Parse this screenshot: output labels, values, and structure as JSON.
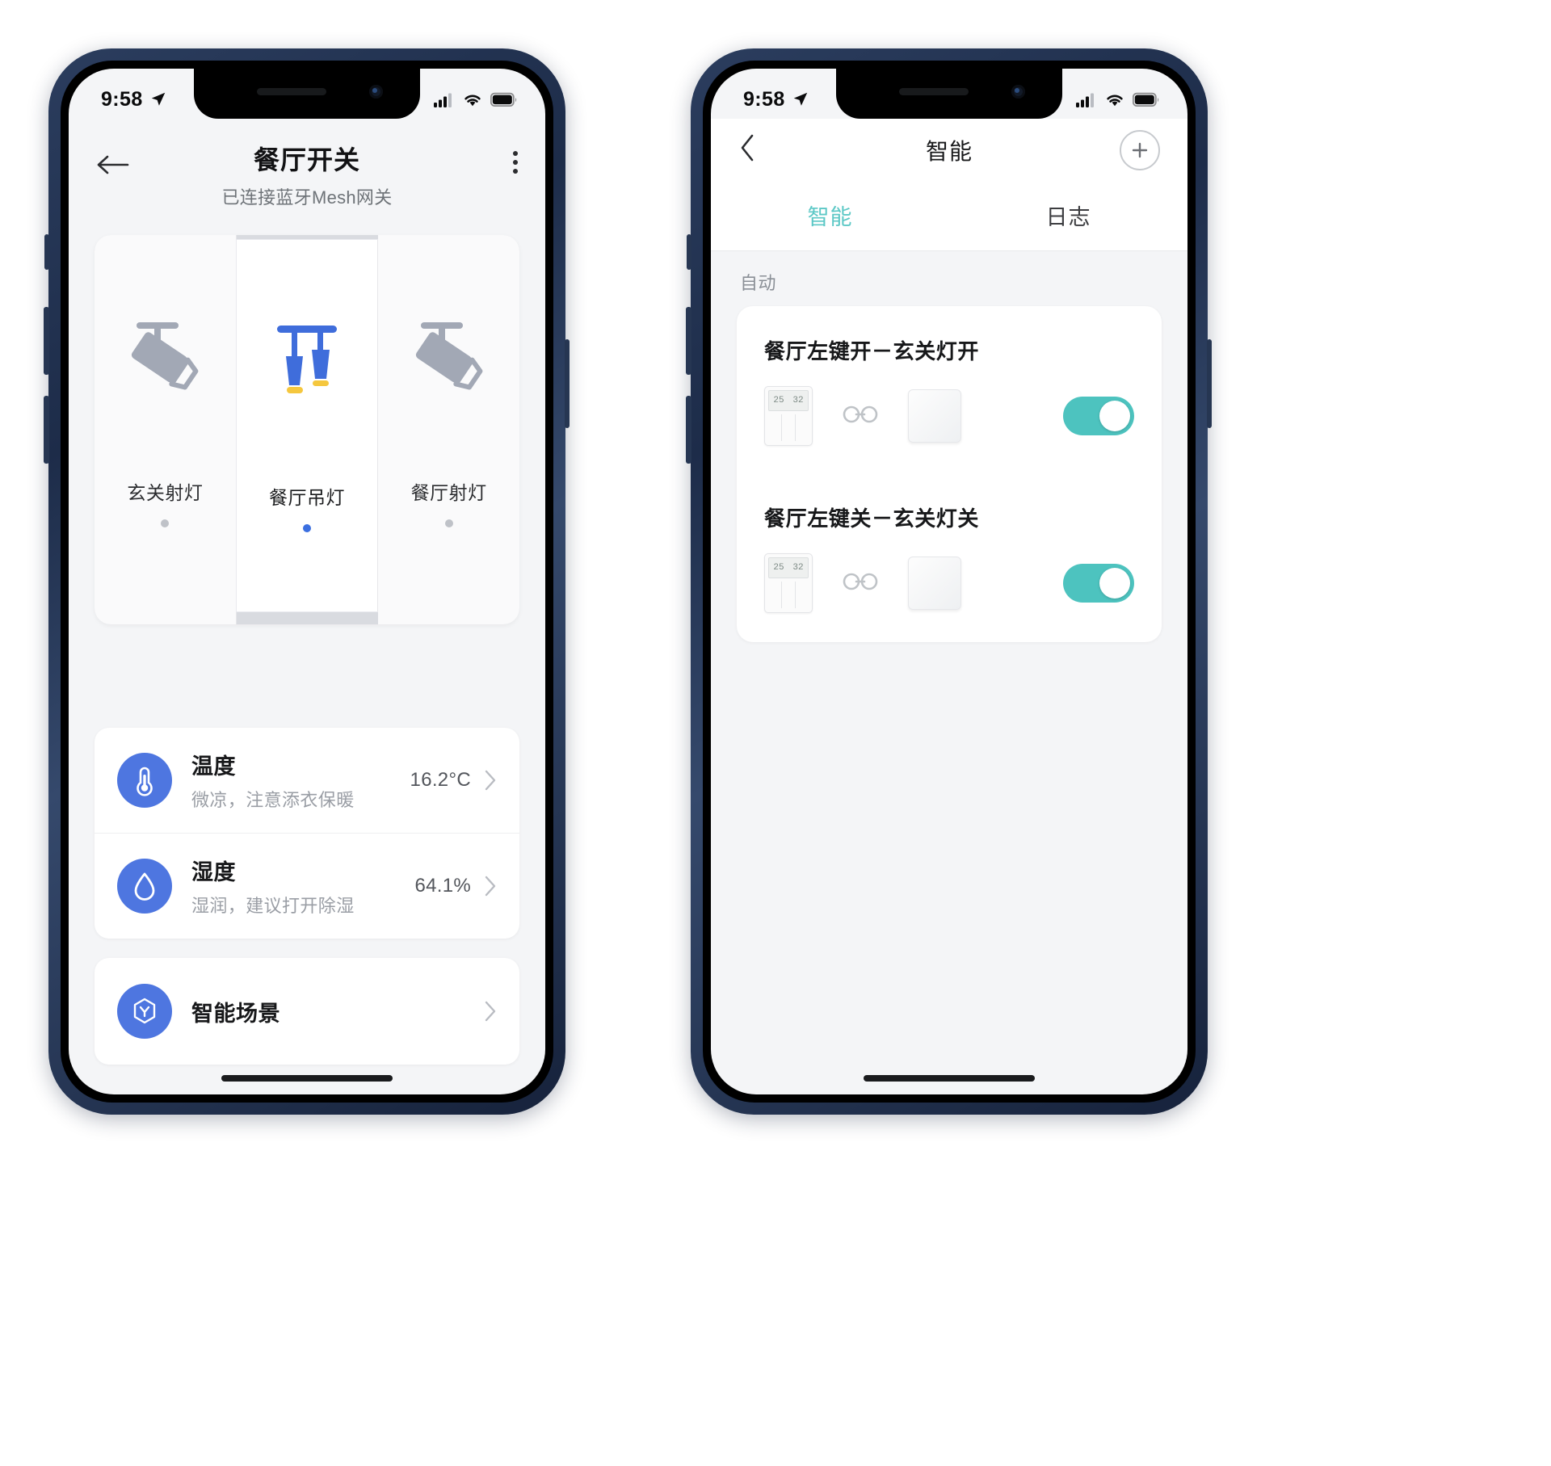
{
  "status_bar": {
    "time": "9:58",
    "location_icon": "location-arrow-icon",
    "signal_icon": "cellular-signal-icon",
    "wifi_icon": "wifi-icon",
    "battery_icon": "battery-full-icon"
  },
  "left_screen": {
    "nav": {
      "back_icon": "arrow-left-icon",
      "title": "餐厅开关",
      "subtitle": "已连接蓝牙Mesh网关",
      "more_icon": "more-vertical-icon"
    },
    "lights": [
      {
        "name": "玄关射灯",
        "icon": "spotlight-icon",
        "state": "off",
        "active": false
      },
      {
        "name": "餐厅吊灯",
        "icon": "pendant-lamp-icon",
        "state": "on",
        "active": true
      },
      {
        "name": "餐厅射灯",
        "icon": "spotlight-icon",
        "state": "off",
        "active": false
      }
    ],
    "sensors": [
      {
        "icon": "thermometer-icon",
        "title": "温度",
        "desc": "微凉，注意添衣保暖",
        "value": "16.2°C",
        "chevron": "chevron-right-icon"
      },
      {
        "icon": "humidity-drop-icon",
        "title": "湿度",
        "desc": "湿润，建议打开除湿",
        "value": "64.1%",
        "chevron": "chevron-right-icon"
      }
    ],
    "scene": {
      "icon": "smart-scene-icon",
      "title": "智能场景",
      "chevron": "chevron-right-icon"
    }
  },
  "right_screen": {
    "nav": {
      "back_icon": "chevron-left-icon",
      "title": "智能",
      "add_icon": "plus-circle-icon"
    },
    "tabs": [
      {
        "label": "智能",
        "active": true
      },
      {
        "label": "日志",
        "active": false
      }
    ],
    "section_label": "自动",
    "automations": [
      {
        "name": "餐厅左键开－玄关灯开",
        "trigger_device_icon": "wall-switch-3gang-icon",
        "trigger_display_left": "25",
        "trigger_display_right": "32",
        "link_icon": "link-chain-icon",
        "action_device_icon": "switch-panel-icon",
        "toggle_state": "on",
        "toggle_color": "#4dc3bf"
      },
      {
        "name": "餐厅左键关－玄关灯关",
        "trigger_device_icon": "wall-switch-3gang-icon",
        "trigger_display_left": "25",
        "trigger_display_right": "32",
        "link_icon": "link-chain-icon",
        "action_device_icon": "switch-panel-icon",
        "toggle_state": "on",
        "toggle_color": "#4dc3bf"
      }
    ]
  },
  "colors": {
    "accent_blue": "#4e76e0",
    "accent_teal": "#5cc8c6",
    "light_on_blue": "#3f6ddb",
    "light_off_gray": "#a2a8b5"
  }
}
